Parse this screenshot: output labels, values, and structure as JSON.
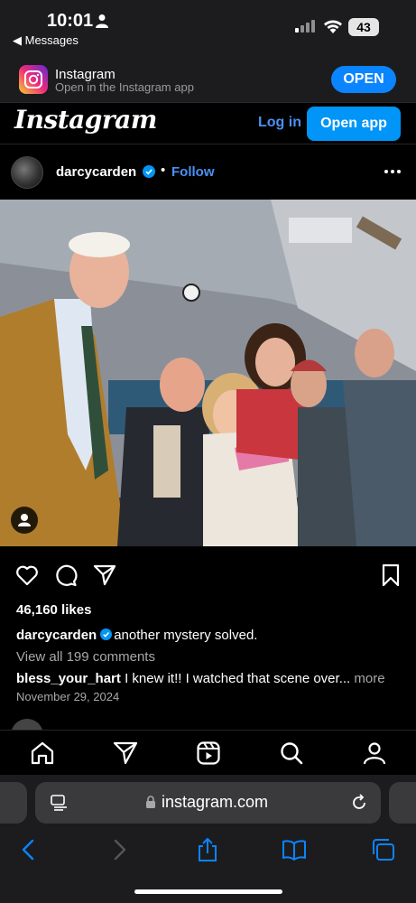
{
  "status_bar": {
    "time": "10:01",
    "back_label": "◀ Messages",
    "battery": "43"
  },
  "app_banner": {
    "title": "Instagram",
    "subtitle": "Open in the Instagram app",
    "open_button": "OPEN"
  },
  "instagram_header": {
    "logo": "Instagram",
    "login_label": "Log in",
    "open_app_label": "Open app"
  },
  "post": {
    "username": "darcycarden",
    "separator": "•",
    "follow_label": "Follow",
    "likes": "46,160 likes",
    "caption_user": "darcycarden",
    "caption_text": "another mystery solved.",
    "view_comments": "View all 199 comments",
    "comment_user": "bless_your_hart",
    "comment_text": "I knew it!! I watched that scene over...",
    "comment_more": "more",
    "date": "November 29, 2024"
  },
  "browser": {
    "url": "instagram.com"
  },
  "colors": {
    "accent_blue": "#0095f6",
    "link_blue": "#4a90f5",
    "ios_blue": "#0a84ff",
    "background": "#000000",
    "toolbar": "#1c1c1e"
  },
  "icons": {
    "post_actions": [
      "heart-icon",
      "comment-icon",
      "share-icon",
      "bookmark-icon"
    ],
    "bottom_nav": [
      "home-icon",
      "explore-send-icon",
      "reels-icon",
      "search-icon",
      "profile-icon"
    ],
    "safari_toolbar": [
      "back-icon",
      "forward-icon",
      "share-icon",
      "bookmarks-icon",
      "tabs-icon"
    ]
  }
}
